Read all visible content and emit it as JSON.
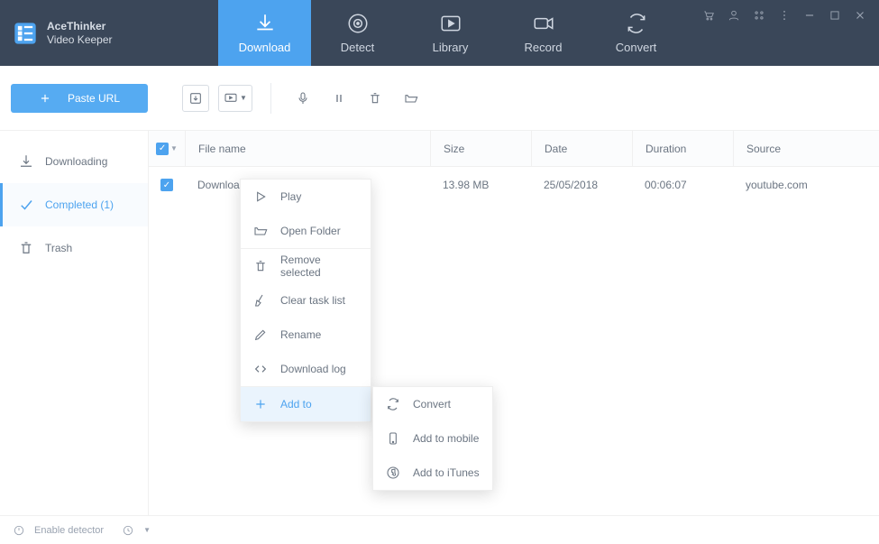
{
  "app": {
    "name_line1": "AceThinker",
    "name_line2": "Video Keeper"
  },
  "nav": {
    "download": "Download",
    "detect": "Detect",
    "library": "Library",
    "record": "Record",
    "convert": "Convert"
  },
  "toolbar": {
    "paste_url": "Paste URL"
  },
  "sidebar": {
    "downloading": "Downloading",
    "completed": "Completed (1)",
    "trash": "Trash"
  },
  "table": {
    "headers": {
      "filename": "File name",
      "size": "Size",
      "date": "Date",
      "duration": "Duration",
      "source": "Source"
    },
    "rows": [
      {
        "filename": "Download ap",
        "size": "13.98 MB",
        "date": "25/05/2018",
        "duration": "00:06:07",
        "source": "youtube.com"
      }
    ]
  },
  "context_menu": {
    "play": "Play",
    "open_folder": "Open Folder",
    "remove_selected": "Remove selected",
    "clear_task_list": "Clear task list",
    "rename": "Rename",
    "download_log": "Download log",
    "add_to": "Add to"
  },
  "submenu": {
    "convert": "Convert",
    "add_to_mobile": "Add to mobile",
    "add_to_itunes": "Add to iTunes"
  },
  "statusbar": {
    "enable_detector": "Enable detector"
  }
}
